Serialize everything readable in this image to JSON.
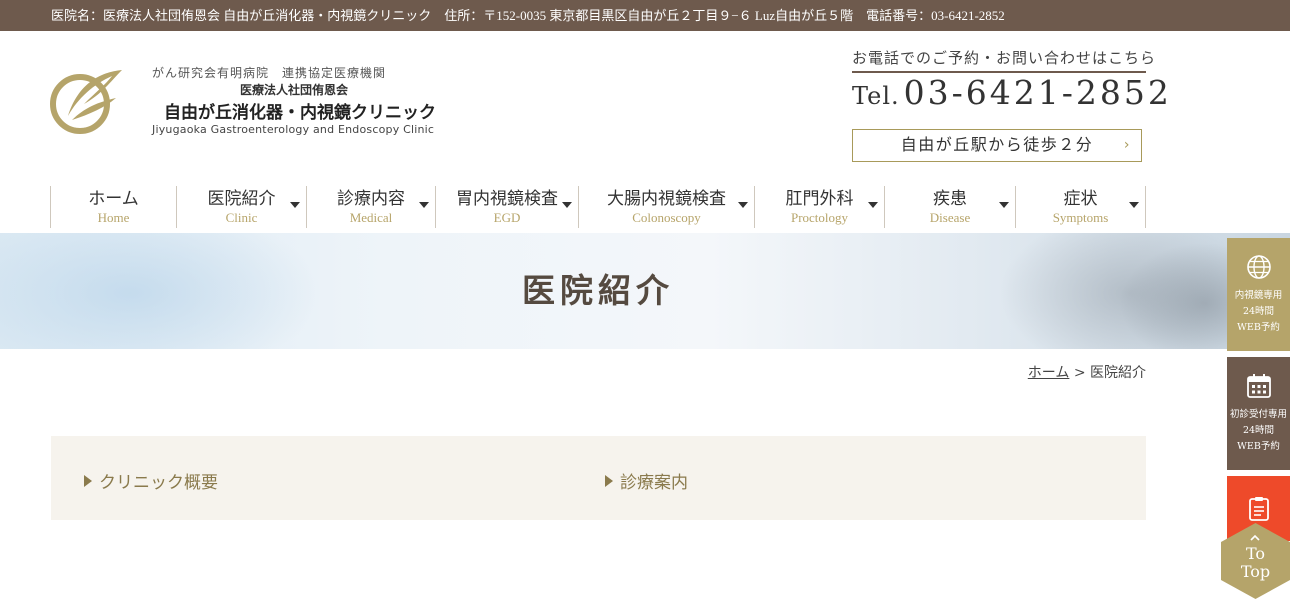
{
  "topbar": {
    "info": "医院名：医療法人社団侑恩会 自由が丘消化器・内視鏡クリニック　住所：〒152-0035 東京都目黒区自由が丘２丁目９−６ Luz自由が丘５階　電話番号：03-6421-2852"
  },
  "header": {
    "logo_line1": "がん研究会有明病院　連携協定医療機関",
    "logo_line2": "医療法人社団侑恩会",
    "logo_line3": "自由が丘消化器・内視鏡クリニック",
    "logo_line4": "Jiyugaoka Gastroenterology and Endoscopy Clinic",
    "tel_caption": "お電話でのご予約・お問い合わせはこちら",
    "tel_prefix": "Tel.",
    "tel_number": "03-6421-2852",
    "access_label": "自由が丘駅から徒歩２分",
    "access_chevron": "›"
  },
  "nav": {
    "items": [
      {
        "jp": "ホーム",
        "en": "Home",
        "dropdown": false
      },
      {
        "jp": "医院紹介",
        "en": "Clinic",
        "dropdown": true
      },
      {
        "jp": "診療内容",
        "en": "Medical",
        "dropdown": true
      },
      {
        "jp": "胃内視鏡検査",
        "en": "EGD",
        "dropdown": true
      },
      {
        "jp": "大腸内視鏡検査",
        "en": "Colonoscopy",
        "dropdown": true
      },
      {
        "jp": "肛門外科",
        "en": "Proctology",
        "dropdown": true
      },
      {
        "jp": "疾患",
        "en": "Disease",
        "dropdown": true
      },
      {
        "jp": "症状",
        "en": "Symptoms",
        "dropdown": true
      }
    ]
  },
  "hero": {
    "title": "医院紹介"
  },
  "breadcrumb": {
    "home": "ホーム",
    "separator": ">",
    "current": "医院紹介"
  },
  "content": {
    "links": [
      {
        "label": "クリニック概要"
      },
      {
        "label": "診療案内"
      }
    ]
  },
  "side": {
    "web_label": "内視鏡専用\n24時間\nWEB予約",
    "first_label": "初診受付専用\n24時間\nWEB予約",
    "to_top": "To\nTop"
  },
  "colors": {
    "brand_brown": "#6e5a4d",
    "gold": "#b5a46a",
    "accent_red": "#ee4a2a"
  }
}
